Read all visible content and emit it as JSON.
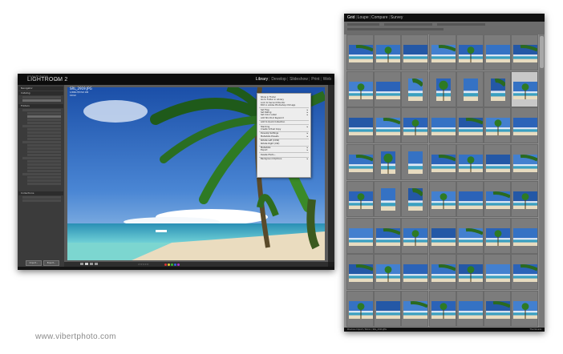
{
  "app": {
    "logo_small": "Adobe Photoshop",
    "logo": "LIGHTROOM 2",
    "user": "Vibe"
  },
  "modules": [
    "Library",
    "Develop",
    "Slideshow",
    "Print",
    "Web"
  ],
  "active_module": "Library",
  "left_panel": {
    "navigator": "Navigator",
    "catalog": "Catalog",
    "folders": "Folders",
    "collections": "Collections",
    "buttons": [
      "Import...",
      "Export..."
    ]
  },
  "photo_info": {
    "filename": "SRL_2919.JPG",
    "line2": "1/400s f/8 ISO 100",
    "line3": "10mm"
  },
  "context_menu": {
    "items": [
      {
        "label": "Show in Finder",
        "submenu": false
      },
      {
        "label": "Go to Folder in Library",
        "submenu": false
      },
      {
        "label": "Lock to Second Monitor",
        "submenu": false
      },
      {
        "label": "Edit in Adobe Photoshop CS3.app",
        "submenu": false
      },
      {
        "sep": true
      },
      {
        "label": "Set Flag",
        "submenu": true
      },
      {
        "label": "Set Rating",
        "submenu": true
      },
      {
        "label": "Set Color Label",
        "submenu": true
      },
      {
        "label": "Add Shortcut Keyword",
        "submenu": false
      },
      {
        "sep": true
      },
      {
        "label": "Add to Quick Collection",
        "submenu": false
      },
      {
        "sep": true
      },
      {
        "label": "Stacking",
        "submenu": true
      },
      {
        "label": "Create Virtual Copy",
        "submenu": false
      },
      {
        "sep": true
      },
      {
        "label": "Develop Settings",
        "submenu": true
      },
      {
        "label": "Metadata Presets",
        "submenu": true
      },
      {
        "sep": true
      },
      {
        "label": "Rotate Left (CCW)",
        "submenu": false
      },
      {
        "label": "Rotate Right (CW)",
        "submenu": false
      },
      {
        "sep": true
      },
      {
        "label": "Metadata",
        "submenu": true
      },
      {
        "label": "Export",
        "submenu": true
      },
      {
        "sep": true
      },
      {
        "label": "Delete Photo...",
        "submenu": false
      },
      {
        "sep": true
      },
      {
        "label": "Background Options",
        "submenu": true
      }
    ]
  },
  "grid": {
    "views": [
      "Grid",
      "Loupe",
      "Compare",
      "Survey"
    ],
    "active_view": "Grid",
    "status_left": "Previous Import / Bohol / SRL_2919.JPG",
    "status_right": "Thumbnails",
    "rows": [
      [
        "L",
        "L",
        "L",
        "L",
        "L",
        "L",
        "L"
      ],
      [
        "L",
        "L",
        "P",
        "P",
        "P",
        "P",
        "Ls"
      ],
      [
        "L",
        "L",
        "L",
        "L",
        "L",
        "L",
        "L"
      ],
      [
        "L",
        "P",
        "P",
        "L",
        "L",
        "L",
        "L"
      ],
      [
        "L",
        "P",
        "P",
        "L",
        "L",
        "L",
        "L"
      ],
      [
        "L",
        "L",
        "L",
        "L",
        "L",
        "L",
        "L"
      ],
      [
        "L",
        "L",
        "L",
        "L",
        "L",
        "L",
        "L"
      ],
      [
        "L",
        "L",
        "L",
        "L",
        "L",
        "L",
        "L"
      ]
    ]
  },
  "watermark": "www.vibertphoto.com"
}
